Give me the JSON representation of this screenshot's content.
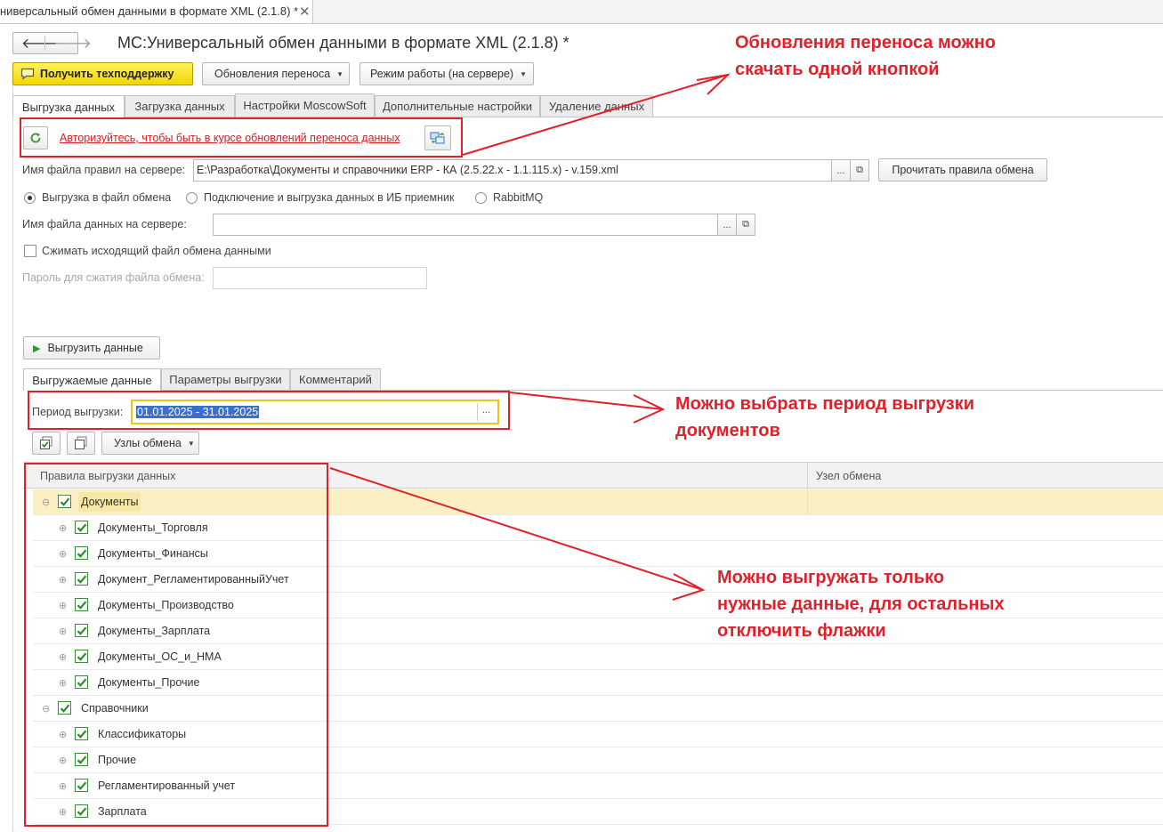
{
  "window": {
    "tab_title": "ниверсальный обмен данными в формате XML (2.1.8) *",
    "form_title": "МС:Универсальный обмен данными в формате XML (2.1.8) *"
  },
  "nav": {
    "back_glyph": "🡐",
    "forward_glyph": "🡒"
  },
  "toolbar": {
    "support_label": "Получить техподдержку",
    "updates_label": "Обновления переноса",
    "mode_label": "Режим работы (на сервере)"
  },
  "main_tabs": [
    "Выгрузка данных",
    "Загрузка данных",
    "Настройки MoscowSoft",
    "Дополнительные настройки",
    "Удаление данных"
  ],
  "auth": {
    "link_text": "Авторизуйтесь, чтобы быть в курсе обновлений переноса данных"
  },
  "rules_file": {
    "label": "Имя файла правил на сервере:",
    "value": "E:\\Разработка\\Документы и справочники ERP - КА (2.5.22.x - 1.1.115.x) - v.159.xml",
    "ellipsis": "...",
    "read_button": "Прочитать правила обмена"
  },
  "export_mode": {
    "options": [
      "Выгрузка в файл обмена",
      "Подключение и выгрузка данных в ИБ приемник",
      "RabbitMQ"
    ],
    "selected": 0
  },
  "data_file": {
    "label": "Имя файла данных на сервере:",
    "value": "",
    "ellipsis": "..."
  },
  "compress": {
    "label": "Сжимать исходящий файл обмена данными",
    "checked": false
  },
  "password": {
    "label": "Пароль для сжатия файла обмена:",
    "value": ""
  },
  "export_button": "Выгрузить данные",
  "sub_tabs": [
    "Выгружаемые данные",
    "Параметры выгрузки",
    "Комментарий"
  ],
  "period": {
    "label": "Период выгрузки:",
    "value": "01.01.2025 - 31.01.2025",
    "ellipsis": "..."
  },
  "nodes_button": "Узлы обмена",
  "tree": {
    "columns": [
      "Правила выгрузки данных",
      "Узел обмена"
    ],
    "rows": [
      {
        "text": "Документы",
        "level": 0,
        "toggle": "⊖",
        "checked": true
      },
      {
        "text": "Документы_Торговля",
        "level": 1,
        "toggle": "⊕",
        "checked": true
      },
      {
        "text": "Документы_Финансы",
        "level": 1,
        "toggle": "⊕",
        "checked": true
      },
      {
        "text": "Документ_РегламентированныйУчет",
        "level": 1,
        "toggle": "⊕",
        "checked": true
      },
      {
        "text": "Документы_Производство",
        "level": 1,
        "toggle": "⊕",
        "checked": true
      },
      {
        "text": "Документы_Зарплата",
        "level": 1,
        "toggle": "⊕",
        "checked": true
      },
      {
        "text": "Документы_ОС_и_НМА",
        "level": 1,
        "toggle": "⊕",
        "checked": true
      },
      {
        "text": "Документы_Прочие",
        "level": 1,
        "toggle": "⊕",
        "checked": true
      },
      {
        "text": "Справочники",
        "level": 0,
        "toggle": "⊖",
        "checked": true
      },
      {
        "text": "Классификаторы",
        "level": 1,
        "toggle": "⊕",
        "checked": true
      },
      {
        "text": "Прочие",
        "level": 1,
        "toggle": "⊕",
        "checked": true
      },
      {
        "text": "Регламентированный учет",
        "level": 1,
        "toggle": "⊕",
        "checked": true
      },
      {
        "text": "Зарплата",
        "level": 1,
        "toggle": "⊕",
        "checked": true
      }
    ]
  },
  "annotations": {
    "updates_line1": "Обновления переноса можно",
    "updates_line2": "скачать одной кнопкой",
    "period_line1": "Можно выбрать период выгрузки",
    "period_line2": "документов",
    "flags_line1": "Можно выгружать только",
    "flags_line2": "нужные данные, для остальных",
    "flags_line3": "отключить флажки"
  },
  "colors": {
    "accent_red": "#e0212b",
    "support_yellow": "#f2d600",
    "selection": "#fbf0c4",
    "check_green": "#2e8b2e"
  }
}
